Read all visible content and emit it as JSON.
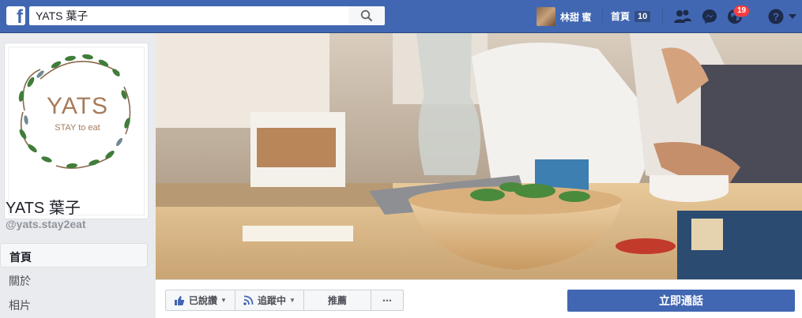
{
  "topbar": {
    "search_value": "YATS 葉子",
    "profile_name": "林甜 蜜",
    "home_label": "首頁",
    "home_count": "10",
    "notification_count": "19"
  },
  "page": {
    "logo_text": "YATS",
    "logo_tagline": "STAY to eat",
    "title": "YATS 葉子",
    "handle": "@yats.stay2eat"
  },
  "sidebar": {
    "items": [
      {
        "label": "首頁"
      },
      {
        "label": "關於"
      },
      {
        "label": "相片"
      }
    ]
  },
  "actions": {
    "like_label": "已說讚",
    "follow_label": "追蹤中",
    "recommend_label": "推薦",
    "more_label": "⋯",
    "cta_label": "立即通話"
  },
  "colors": {
    "brand_blue": "#4267b2",
    "badge_red": "#fa3e3e",
    "logo_brown": "#a67b5b",
    "logo_green": "#3f7d3a"
  },
  "icons": [
    "facebook-logo-icon",
    "search-icon",
    "friends-icon",
    "messenger-icon",
    "globe-notifications-icon",
    "help-icon",
    "dropdown-caret-icon",
    "like-thumb-icon",
    "rss-follow-icon"
  ]
}
